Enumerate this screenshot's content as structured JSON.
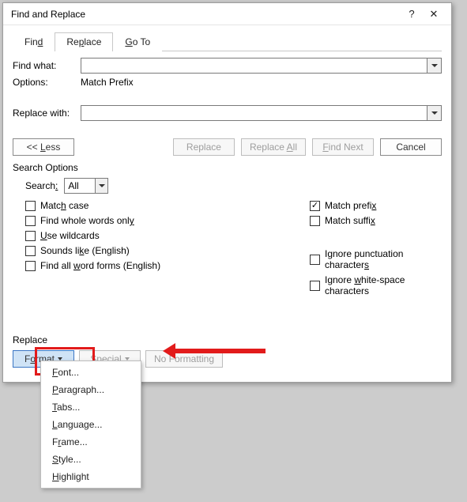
{
  "title": "Find and Replace",
  "tabs": {
    "find": "Find",
    "replace": "Replace",
    "goto": "Go To"
  },
  "labels": {
    "find_what": "Find what:",
    "options": "Options:",
    "options_value": "Match Prefix",
    "replace_with": "Replace with:"
  },
  "buttons": {
    "less": "<< Less",
    "replace": "Replace",
    "replace_all": "Replace All",
    "find_next": "Find Next",
    "cancel": "Cancel",
    "format": "Format",
    "special": "Special",
    "no_formatting": "No Formatting"
  },
  "search_options": {
    "title": "Search Options",
    "search_label": "Search:",
    "search_value": "All",
    "match_case": "Match case",
    "whole_words": "Find whole words only",
    "use_wildcards": "Use wildcards",
    "sounds_like": "Sounds like (English)",
    "word_forms": "Find all word forms (English)",
    "match_prefix": "Match prefix",
    "match_suffix": "Match suffix",
    "ignore_punct": "Ignore punctuation characters",
    "ignore_ws": "Ignore white-space characters"
  },
  "replace_section": {
    "title": "Replace"
  },
  "menu": {
    "font": "Font...",
    "paragraph": "Paragraph...",
    "tabs": "Tabs...",
    "language": "Language...",
    "frame": "Frame...",
    "style": "Style...",
    "highlight": "Highlight"
  }
}
